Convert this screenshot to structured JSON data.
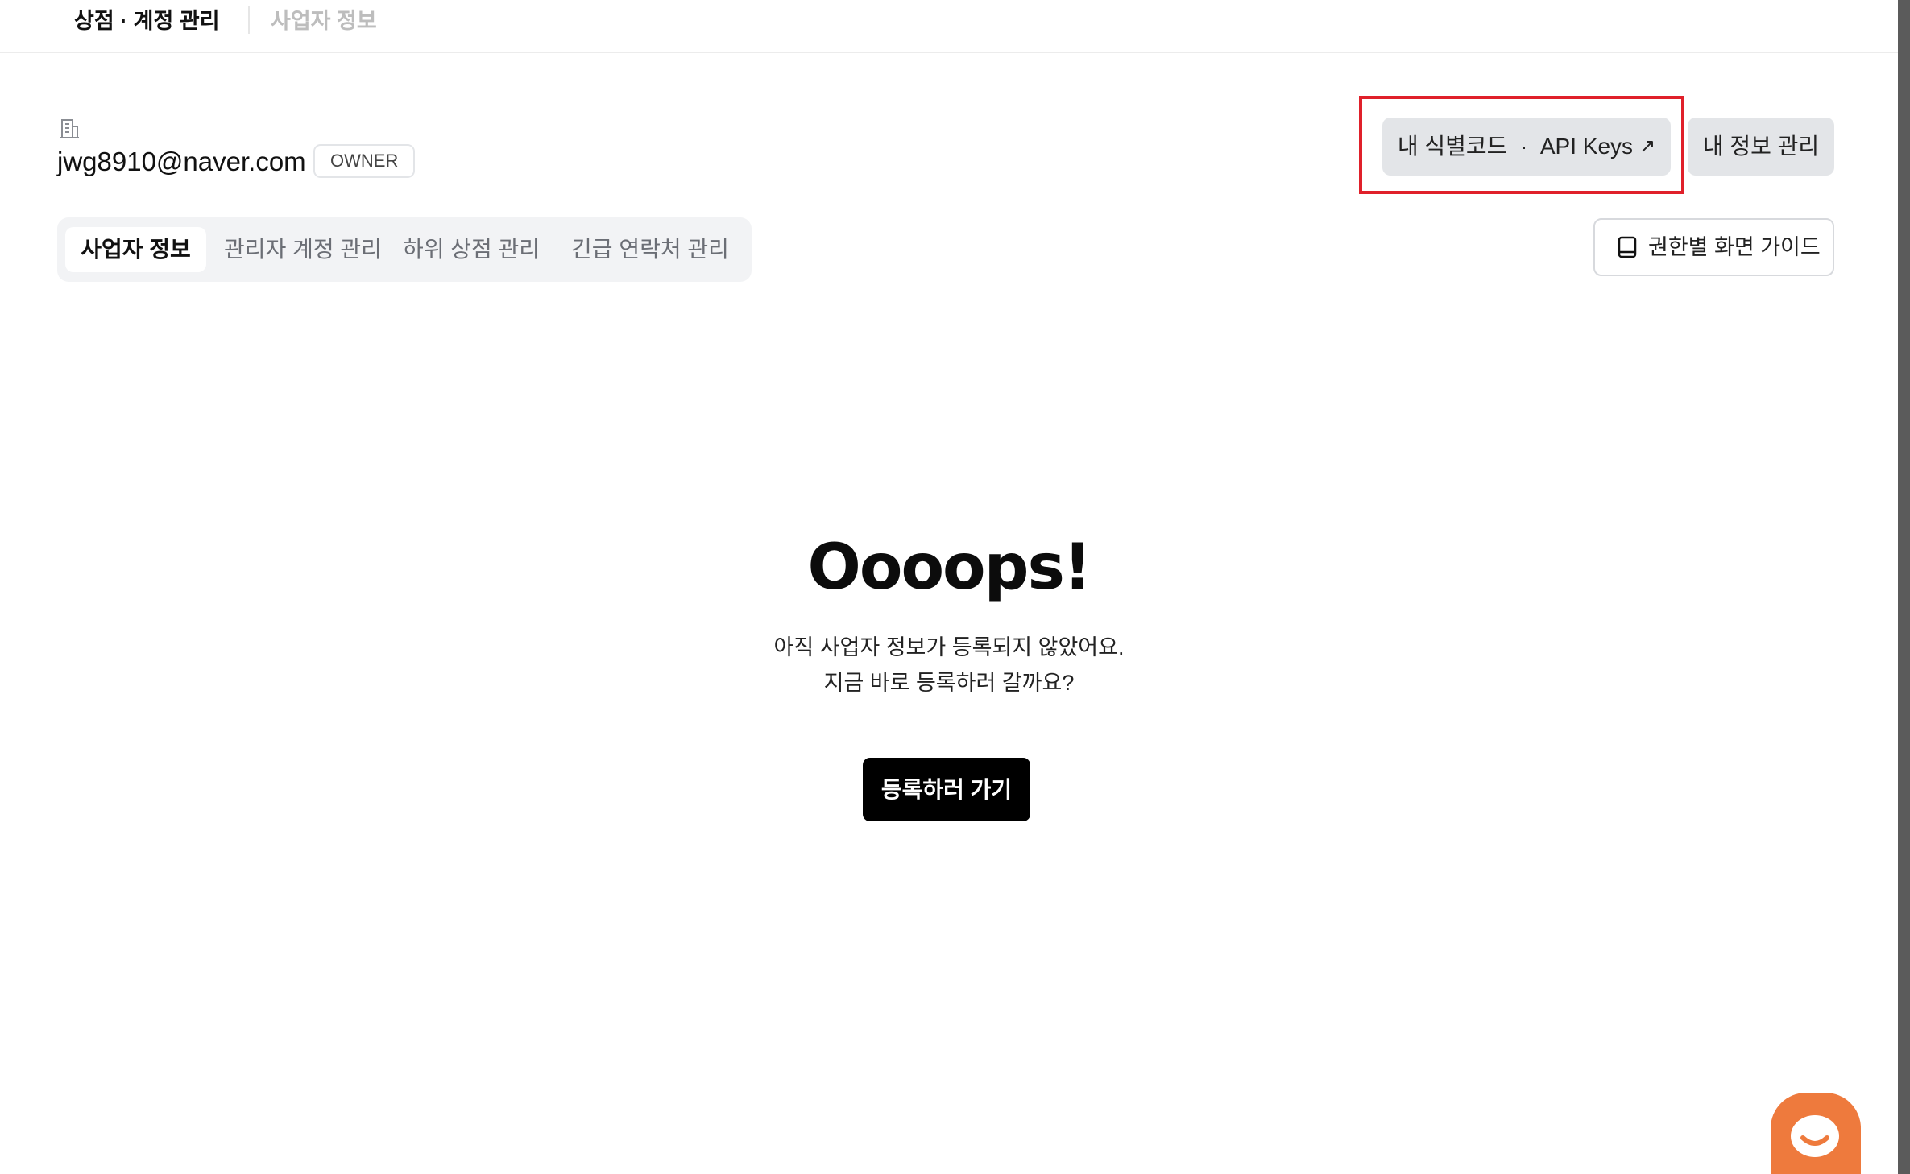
{
  "header": {
    "breadcrumb_main": "상점 · 계정 관리",
    "breadcrumb_current": "사업자 정보"
  },
  "account": {
    "icon": "building-icon",
    "email": "jwg8910@naver.com",
    "role_badge": "OWNER"
  },
  "actions": {
    "api_keys_label": "내 식별코드  ·  API Keys",
    "api_keys_icon": "external-arrow-icon",
    "my_info_label": "내 정보 관리",
    "guide_label": "권한별 화면 가이드",
    "guide_icon": "book-icon"
  },
  "tabs": [
    {
      "label": "사업자 정보",
      "active": true
    },
    {
      "label": "관리자 계정 관리",
      "active": false
    },
    {
      "label": "하위 상점 관리",
      "active": false
    },
    {
      "label": "긴급 연락처 관리",
      "active": false
    }
  ],
  "empty_state": {
    "title": "Oooops!",
    "line1": "아직 사업자 정보가 등록되지 않았어요.",
    "line2": "지금 바로 등록하러 갈까요?",
    "button_label": "등록하러 가기"
  },
  "colors": {
    "highlight": "#e0202a",
    "chat_button": "#ee7a3d",
    "primary_button": "#000000",
    "secondary_button": "#e3e5e8"
  },
  "chat": {
    "icon": "chat-face-icon"
  }
}
